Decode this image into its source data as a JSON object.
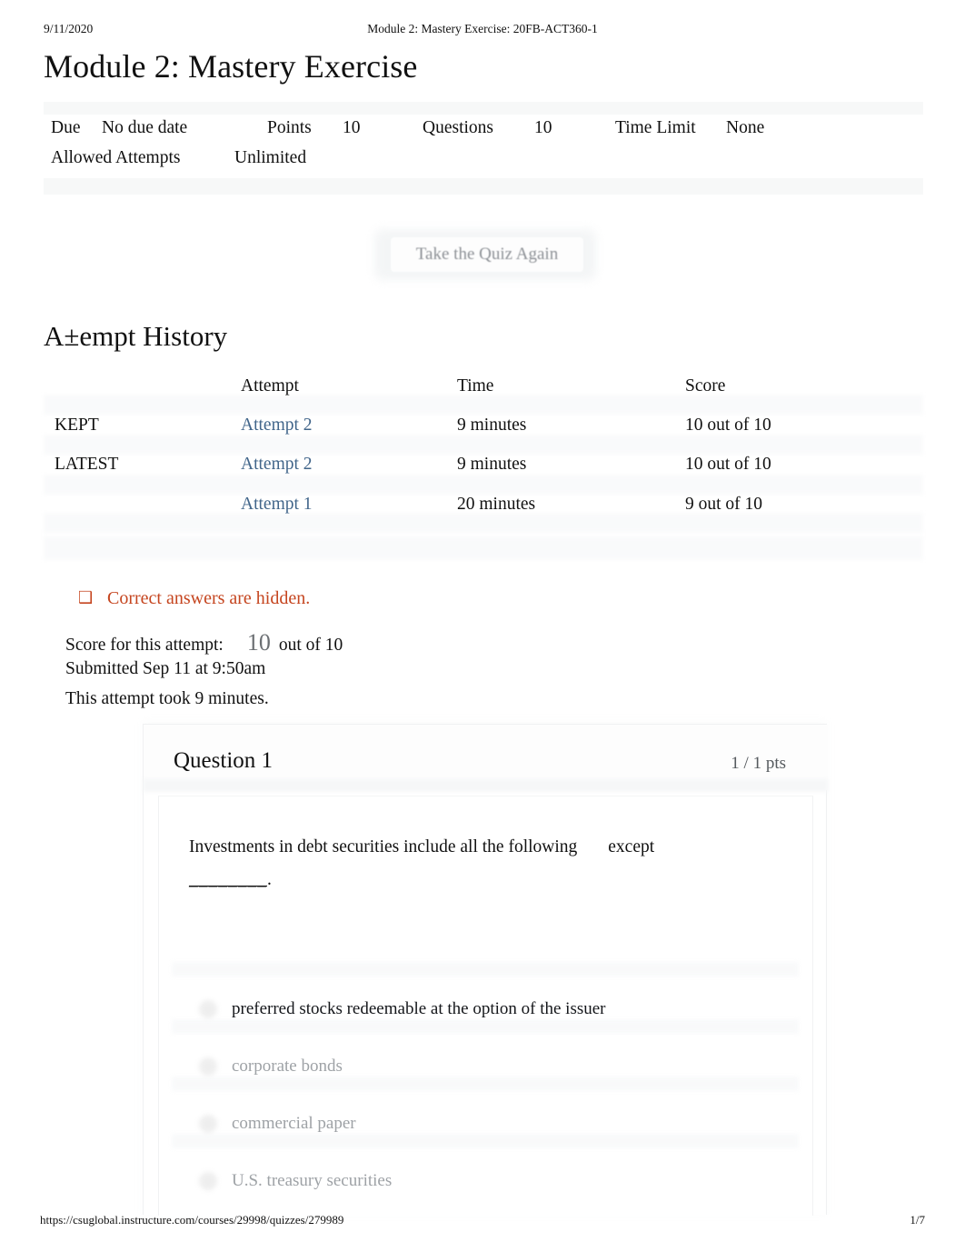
{
  "print_header": {
    "date": "9/11/2020",
    "doc_title": "Module 2: Mastery Exercise: 20FB-ACT360-1"
  },
  "page_title": "Module 2: Mastery Exercise",
  "quiz_meta": {
    "due_label": "Due",
    "due_value": "No due date",
    "points_label": "Points",
    "points_value": "10",
    "questions_label": "Questions",
    "questions_value": "10",
    "time_limit_label": "Time Limit",
    "time_limit_value": "None",
    "allowed_attempts_label": "Allowed Attempts",
    "allowed_attempts_value": "Unlimited"
  },
  "retake_button_label": "Take the Quiz Again",
  "attempt_history": {
    "section_title": "A±empt History",
    "columns": [
      "",
      "Attempt",
      "Time",
      "Score"
    ],
    "rows": [
      {
        "flag": "KEPT",
        "attempt": "Attempt 2",
        "time": "9 minutes",
        "score": "10 out of 10"
      },
      {
        "flag": "LATEST",
        "attempt": "Attempt 2",
        "time": "9 minutes",
        "score": "10 out of 10"
      },
      {
        "flag": "",
        "attempt": "Attempt 1",
        "time": "20 minutes",
        "score": "9 out of 10"
      }
    ]
  },
  "notice": {
    "icon": "warning-icon",
    "glyph": "❑",
    "text": "Correct answers are hidden.",
    "color": "#c5451f"
  },
  "attempt_summary": {
    "score_label": "Score for this attempt:",
    "score_value": "10",
    "score_suffix": "out of 10",
    "submitted": "Submitted Sep 11 at 9:50am",
    "duration": "This attempt took 9 minutes."
  },
  "question": {
    "name": "Question 1",
    "points": "1 / 1 pts",
    "text_part_1": "Investments in debt securities include all the following",
    "text_emphasis": "except",
    "text_blank": "________",
    "text_period": ".",
    "answers": [
      {
        "label": "preferred stocks redeemable at the option of the issuer",
        "selected": true
      },
      {
        "label": "corporate bonds",
        "selected": false
      },
      {
        "label": "commercial paper",
        "selected": false
      },
      {
        "label": "U.S. treasury securities",
        "selected": false
      }
    ]
  },
  "footer": {
    "url": "https://csuglobal.instructure.com/courses/29998/quizzes/279989",
    "page": "1/7"
  }
}
